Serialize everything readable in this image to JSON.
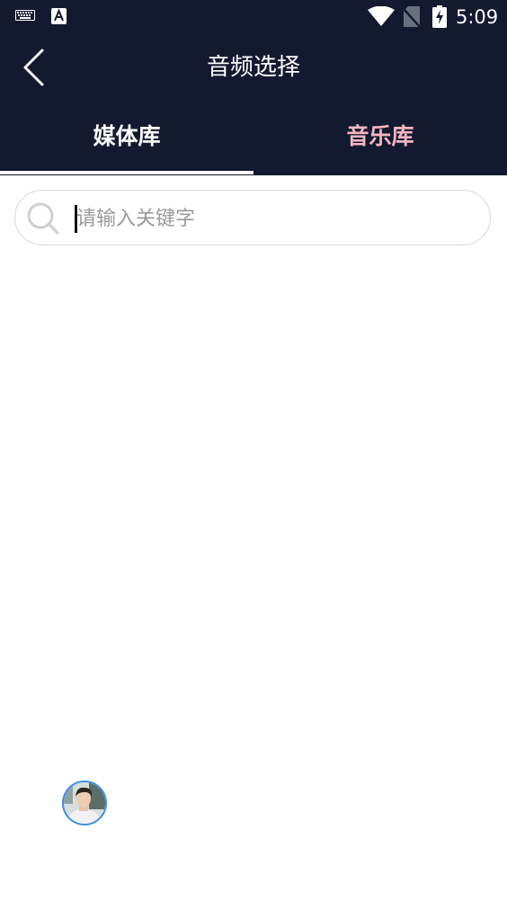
{
  "status_bar": {
    "time": "5:09",
    "icons": [
      "keyboard-icon",
      "a-text-icon",
      "wifi-icon",
      "no-sim-icon",
      "battery-charging-icon"
    ]
  },
  "header": {
    "title": "音频选择",
    "back_icon": "chevron-left-icon"
  },
  "tabs": [
    {
      "label": "媒体库",
      "active": true
    },
    {
      "label": "音乐库",
      "active": false
    }
  ],
  "search": {
    "value": "",
    "placeholder": "请输入关键字",
    "icon": "search-icon"
  },
  "floating_avatar": {
    "icon": "user-avatar"
  },
  "colors": {
    "header_bg": "#131a30",
    "active_tab": "#ffffff",
    "inactive_tab": "#f4b6c0",
    "avatar_ring": "#3d8ee6"
  }
}
